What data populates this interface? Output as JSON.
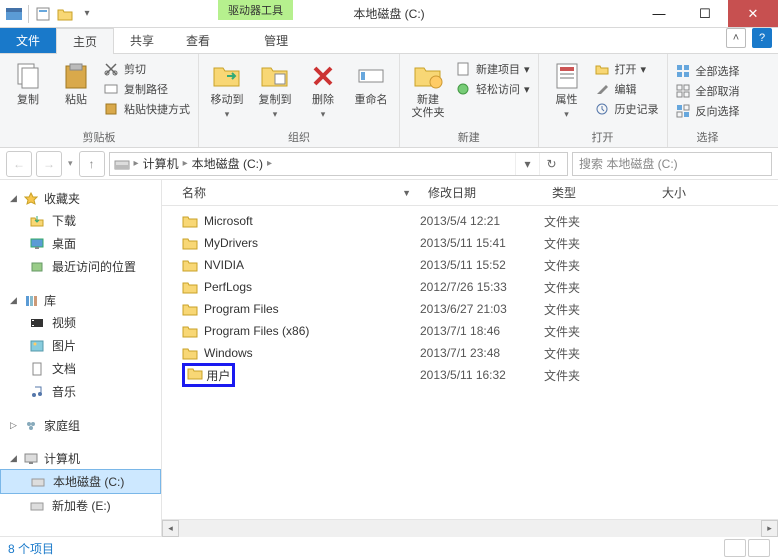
{
  "title": "本地磁盘 (C:)",
  "drive_tools_label": "驱动器工具",
  "tabs": {
    "file": "文件",
    "home": "主页",
    "share": "共享",
    "view": "查看",
    "manage": "管理"
  },
  "ribbon": {
    "clipboard": {
      "copy": "复制",
      "paste": "粘贴",
      "cut": "剪切",
      "copy_path": "复制路径",
      "paste_shortcut": "粘贴快捷方式",
      "group": "剪贴板"
    },
    "organize": {
      "move_to": "移动到",
      "copy_to": "复制到",
      "delete": "删除",
      "rename": "重命名",
      "group": "组织"
    },
    "new": {
      "new_folder": "新建\n文件夹",
      "new_item": "新建项目",
      "easy_access": "轻松访问",
      "group": "新建"
    },
    "open": {
      "properties": "属性",
      "open": "打开",
      "edit": "编辑",
      "history": "历史记录",
      "group": "打开"
    },
    "select": {
      "select_all": "全部选择",
      "select_none": "全部取消",
      "invert": "反向选择",
      "group": "选择"
    }
  },
  "breadcrumb": {
    "computer": "计算机",
    "drive": "本地磁盘 (C:)"
  },
  "search_placeholder": "搜索 本地磁盘 (C:)",
  "columns": {
    "name": "名称",
    "date": "修改日期",
    "type": "类型",
    "size": "大小"
  },
  "nav": {
    "favorites": "收藏夹",
    "downloads": "下载",
    "desktop": "桌面",
    "recent": "最近访问的位置",
    "libraries": "库",
    "videos": "视频",
    "pictures": "图片",
    "documents": "文档",
    "music": "音乐",
    "homegroup": "家庭组",
    "computer": "计算机",
    "drive_c": "本地磁盘 (C:)",
    "drive_e": "新加卷 (E:)"
  },
  "files": [
    {
      "name": "Microsoft",
      "date": "2013/5/4 12:21",
      "type": "文件夹"
    },
    {
      "name": "MyDrivers",
      "date": "2013/5/11 15:41",
      "type": "文件夹"
    },
    {
      "name": "NVIDIA",
      "date": "2013/5/11 15:52",
      "type": "文件夹"
    },
    {
      "name": "PerfLogs",
      "date": "2012/7/26 15:33",
      "type": "文件夹"
    },
    {
      "name": "Program Files",
      "date": "2013/6/27 21:03",
      "type": "文件夹"
    },
    {
      "name": "Program Files (x86)",
      "date": "2013/7/1 18:46",
      "type": "文件夹"
    },
    {
      "name": "Windows",
      "date": "2013/7/1 23:48",
      "type": "文件夹"
    },
    {
      "name": "用户",
      "date": "2013/5/11 16:32",
      "type": "文件夹",
      "highlight": true
    }
  ],
  "status_text": "8 个项目"
}
